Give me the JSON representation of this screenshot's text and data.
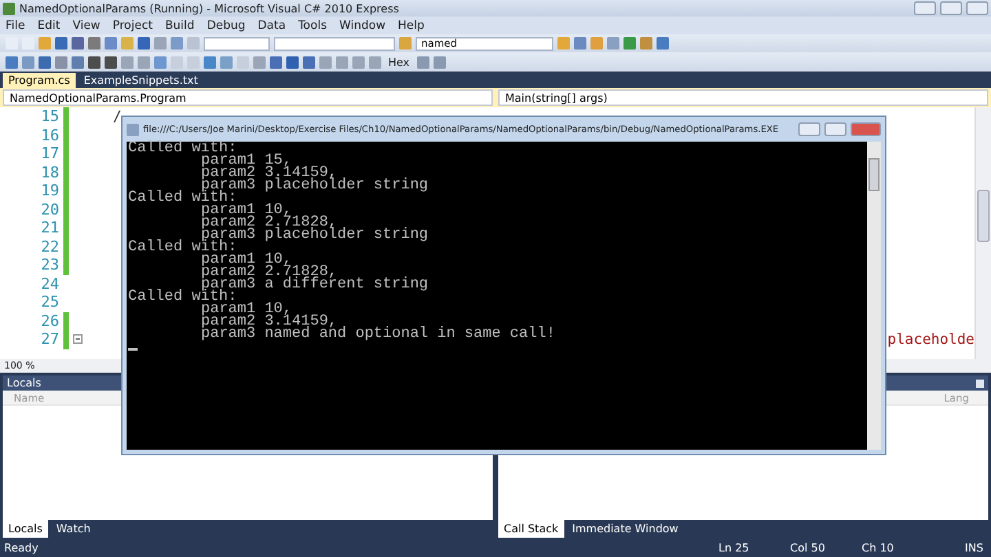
{
  "window": {
    "title": "NamedOptionalParams (Running) - Microsoft Visual C# 2010 Express"
  },
  "menu": [
    "File",
    "Edit",
    "View",
    "Project",
    "Build",
    "Debug",
    "Data",
    "Tools",
    "Window",
    "Help"
  ],
  "toolbar": {
    "find_box": {
      "value": "named"
    },
    "hex_button": "Hex"
  },
  "document_tabs": [
    {
      "label": "Program.cs",
      "selected": true
    },
    {
      "label": "ExampleSnippets.txt",
      "selected": false
    }
  ],
  "navigation": {
    "type_combo": "NamedOptionalParams.Program",
    "member_combo": "Main(string[] args)"
  },
  "editor": {
    "zoom": "100 %",
    "lines": [
      {
        "number": "15",
        "changed": true,
        "collapsible": false,
        "kind": "code",
        "text": "/"
      },
      {
        "number": "16",
        "changed": true,
        "collapsible": false
      },
      {
        "number": "17",
        "changed": true,
        "collapsible": false
      },
      {
        "number": "18",
        "changed": true,
        "collapsible": false
      },
      {
        "number": "19",
        "changed": true,
        "collapsible": false
      },
      {
        "number": "20",
        "changed": true,
        "collapsible": false
      },
      {
        "number": "21",
        "changed": true,
        "collapsible": false
      },
      {
        "number": "22",
        "changed": true,
        "collapsible": false
      },
      {
        "number": "23",
        "changed": true,
        "collapsible": false
      },
      {
        "number": "24",
        "changed": false,
        "collapsible": false
      },
      {
        "number": "25",
        "changed": false,
        "collapsible": false
      },
      {
        "number": "26",
        "changed": true,
        "collapsible": false
      },
      {
        "number": "27",
        "changed": true,
        "collapsible": true,
        "kind": "string",
        "text": "placeholde"
      }
    ]
  },
  "console": {
    "title": "file:///C:/Users/Joe Marini/Desktop/Exercise Files/Ch10/NamedOptionalParams/NamedOptionalParams/bin/Debug/NamedOptionalParams.EXE",
    "lines": [
      {
        "kind": "heading",
        "text": "Called with:"
      },
      {
        "kind": "param",
        "text": "param1 15,"
      },
      {
        "kind": "param",
        "text": "param2 3.14159,"
      },
      {
        "kind": "param",
        "text": "param3 placeholder string"
      },
      {
        "kind": "heading",
        "text": "Called with:"
      },
      {
        "kind": "param",
        "text": "param1 10,"
      },
      {
        "kind": "param",
        "text": "param2 2.71828,"
      },
      {
        "kind": "param",
        "text": "param3 placeholder string"
      },
      {
        "kind": "heading",
        "text": "Called with:"
      },
      {
        "kind": "param",
        "text": "param1 10,"
      },
      {
        "kind": "param",
        "text": "param2 2.71828,"
      },
      {
        "kind": "param",
        "text": "param3 a different string"
      },
      {
        "kind": "heading",
        "text": "Called with:"
      },
      {
        "kind": "param",
        "text": "param1 10,"
      },
      {
        "kind": "param",
        "text": "param2 3.14159,"
      },
      {
        "kind": "param",
        "text": "param3 named and optional in same call!"
      }
    ]
  },
  "panels": [
    {
      "title": "Locals",
      "column": "Name",
      "tabs": [
        {
          "label": "Locals",
          "selected": true
        },
        {
          "label": "Watch",
          "selected": false
        }
      ]
    },
    {
      "column": "Lang",
      "tabs": [
        {
          "label": "Call Stack",
          "selected": true
        },
        {
          "label": "Immediate Window",
          "selected": false
        }
      ]
    }
  ],
  "status_bar": {
    "message": "Ready",
    "line": "Ln 25",
    "column": "Col 50",
    "char": "Ch 10",
    "mode": "INS"
  }
}
